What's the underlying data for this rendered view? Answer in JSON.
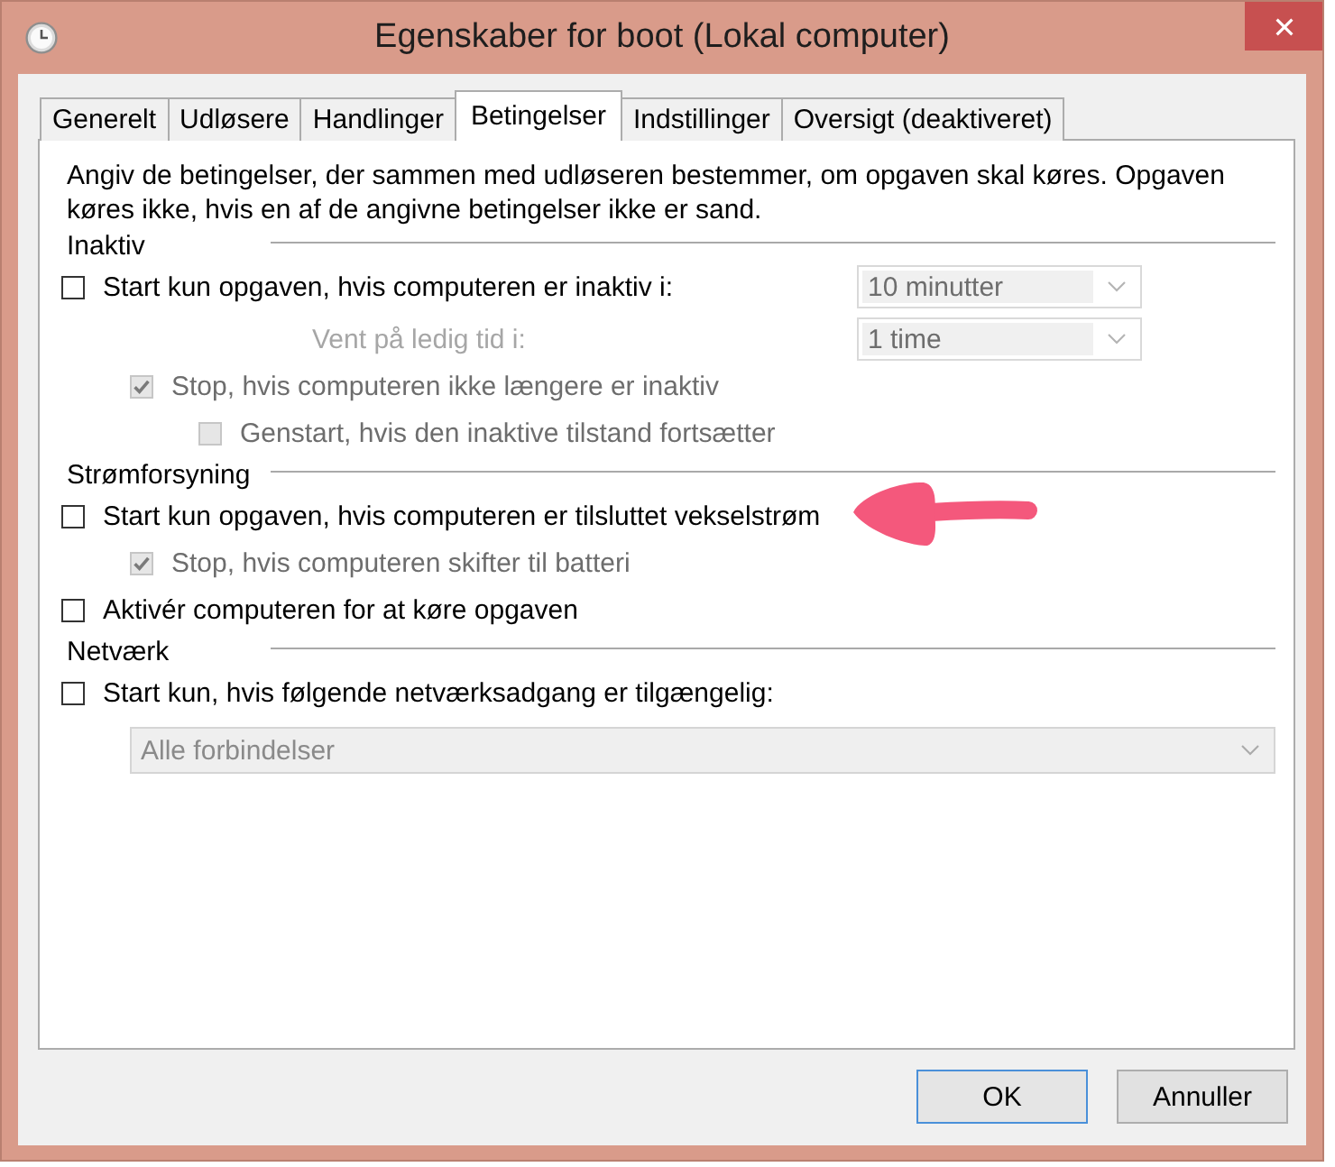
{
  "window": {
    "title": "Egenskaber for boot (Lokal computer)"
  },
  "tabs": [
    {
      "label": "Generelt",
      "selected": false
    },
    {
      "label": "Udløsere",
      "selected": false
    },
    {
      "label": "Handlinger",
      "selected": false
    },
    {
      "label": "Betingelser",
      "selected": true
    },
    {
      "label": "Indstillinger",
      "selected": false
    },
    {
      "label": "Oversigt (deaktiveret)",
      "selected": false
    }
  ],
  "description": "Angiv de betingelser, der sammen med udløseren bestemmer, om opgaven skal køres. Opgaven køres ikke, hvis en af de angivne betingelser ikke er sand.",
  "groups": [
    {
      "title": "Inaktiv",
      "items": [
        {
          "kind": "checkbox",
          "label": "Start kun opgaven, hvis computeren er inaktiv i:",
          "checked": false,
          "disabled": false,
          "dropdown": {
            "value": "10 minutter",
            "disabled": true
          },
          "children": [
            {
              "kind": "field",
              "label": "Vent på ledig tid i:",
              "disabled": true,
              "dropdown": {
                "value": "1 time",
                "disabled": true
              }
            },
            {
              "kind": "checkbox",
              "label": "Stop, hvis computeren ikke længere er inaktiv",
              "checked": true,
              "disabled": true,
              "children": [
                {
                  "kind": "checkbox",
                  "label": "Genstart, hvis den inaktive tilstand fortsætter",
                  "checked": false,
                  "disabled": true
                }
              ]
            }
          ]
        }
      ]
    },
    {
      "title": "Strømforsyning",
      "items": [
        {
          "kind": "checkbox",
          "label": "Start kun opgaven, hvis computeren er tilsluttet vekselstrøm",
          "checked": false,
          "disabled": false,
          "children": [
            {
              "kind": "checkbox",
              "label": "Stop, hvis computeren skifter til batteri",
              "checked": true,
              "disabled": true
            }
          ]
        },
        {
          "kind": "checkbox",
          "label": "Aktivér computeren for at køre opgaven",
          "checked": false,
          "disabled": false
        }
      ]
    },
    {
      "title": "Netværk",
      "items": [
        {
          "kind": "checkbox",
          "label": "Start kun, hvis følgende netværksadgang er tilgængelig:",
          "checked": false,
          "disabled": false,
          "children": [
            {
              "kind": "dropdown",
              "value": "Alle forbindelser",
              "disabled": true
            }
          ]
        }
      ]
    }
  ],
  "annotation": {
    "kind": "arrow"
  },
  "buttons": [
    {
      "label": "OK",
      "default": true
    },
    {
      "label": "Annuller",
      "default": false
    }
  ]
}
